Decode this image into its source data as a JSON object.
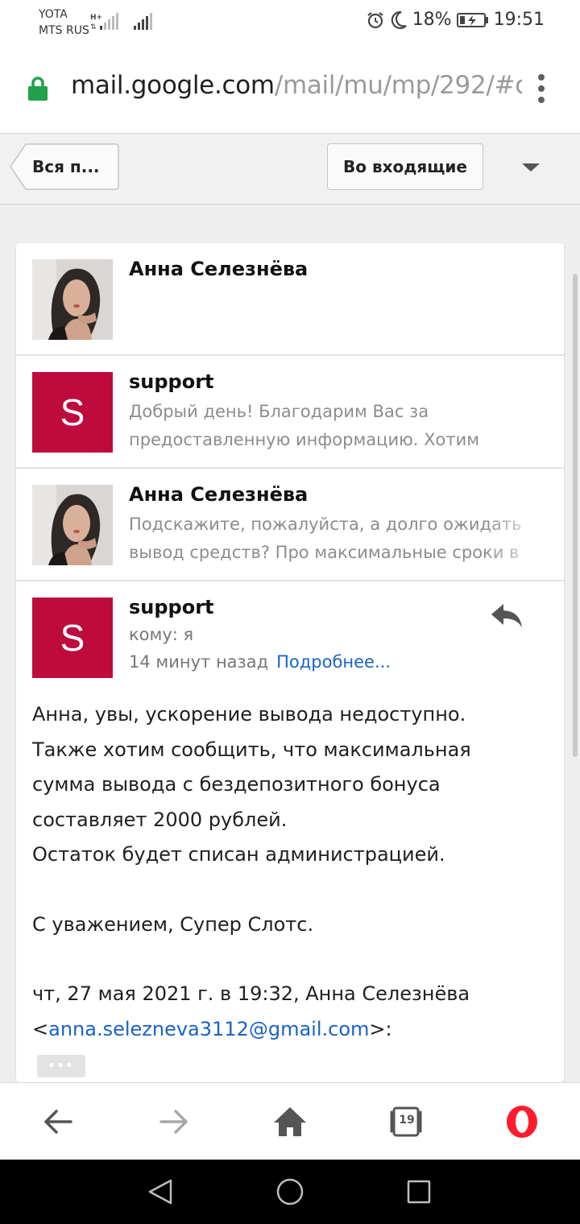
{
  "status_bar": {
    "carrier_1": "YOTA",
    "carrier_2": "MTS RUS",
    "battery": "18%",
    "time": "19:51"
  },
  "url_bar": {
    "host": "mail.google.com",
    "path": "/mail/mu/mp/292/#c"
  },
  "toolbar": {
    "back_label": "Вся п...",
    "inbox_label": "Во входящие"
  },
  "thread": {
    "messages": [
      {
        "sender": "Анна Селезнёва",
        "snippet_1": "",
        "snippet_2": ""
      },
      {
        "sender": "support",
        "avatar_letter": "S",
        "snippet_1": "Добрый день! Благодарим Вас за",
        "snippet_2": "предоставленную информацию. Хотим"
      },
      {
        "sender": "Анна Селезнёва",
        "snippet_1": "Подскажите, пожалуйста, а долго ожидать",
        "snippet_2": "вывод средств? Про максимальные сроки в"
      }
    ],
    "open_message": {
      "sender": "support",
      "avatar_letter": "S",
      "to": "кому: я",
      "time_ago": "14 минут назад",
      "details_link": "Подробнее...",
      "body": [
        "Анна, увы, ускорение вывода недоступно.",
        "Также хотим сообщить, что максимальная",
        "сумма вывода с бездепозитного бонуса",
        "составляет 2000 рублей.",
        "Остаток будет списан администрацией."
      ],
      "signature": "С уважением, Супер Слотс.",
      "quote_header_prefix": "чт, 27 мая 2021 г. в 19:32, Анна Селезнёва <",
      "quote_email": "anna.selezneva3112@gmail.com",
      "quote_header_suffix": ">:",
      "more_dots": "•••"
    }
  },
  "browser_bar": {
    "tabs_count": "19"
  },
  "colors": {
    "avatar_support": "#bf0a3e",
    "link": "#1a62c9",
    "lock": "#22a04b",
    "opera": "#ff1b2d"
  }
}
